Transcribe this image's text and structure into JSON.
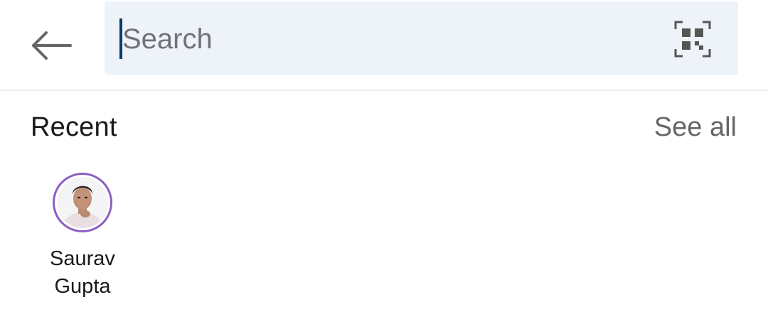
{
  "header": {
    "back_icon": "arrow-left-icon",
    "search": {
      "placeholder": "Search",
      "value": ""
    },
    "qr_icon": "qr-code-scan-icon"
  },
  "recent": {
    "title": "Recent",
    "see_all_label": "See all",
    "items": [
      {
        "name_line1": "Saurav",
        "name_line2": "Gupta",
        "avatar_icon": "profile-photo",
        "ring_color": "#8d5ec4"
      }
    ]
  },
  "colors": {
    "search_background": "#edf3f8",
    "caret": "#0a3b6f",
    "text_primary": "#191919",
    "text_secondary": "#666666"
  }
}
